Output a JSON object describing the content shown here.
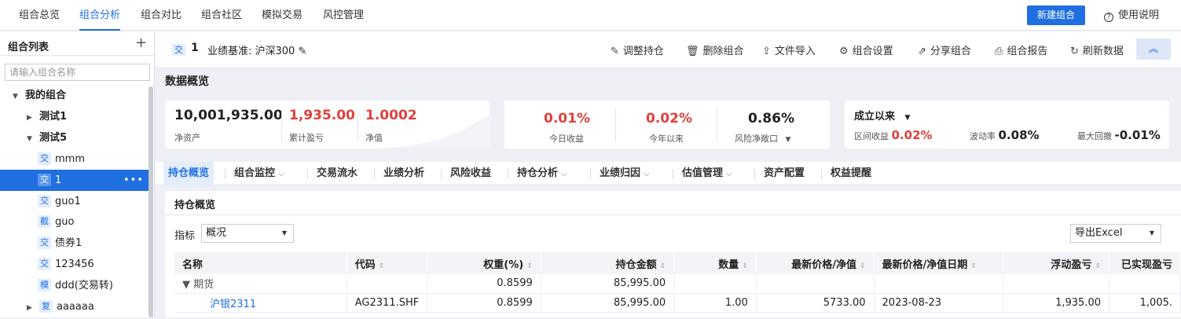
{
  "topnav": {
    "tabs": [
      "组合总览",
      "组合分析",
      "组合对比",
      "组合社区",
      "模拟交易",
      "风控管理"
    ],
    "active": 1,
    "new_button": "新建组合",
    "help": "使用说明"
  },
  "sidebar": {
    "title": "组合列表",
    "search_placeholder": "请输入组合名称",
    "items": [
      {
        "arrow": "▼",
        "tag": "",
        "label": "我的组合"
      },
      {
        "arrow": "▶",
        "tag": "",
        "label": "测试1"
      },
      {
        "arrow": "▼",
        "tag": "",
        "label": "测试5"
      },
      {
        "arrow": "",
        "tag": "交",
        "label": "mmm"
      },
      {
        "arrow": "",
        "tag": "交",
        "label": "1"
      },
      {
        "arrow": "",
        "tag": "交",
        "label": "guo1"
      },
      {
        "arrow": "",
        "tag": "截",
        "label": "guo"
      },
      {
        "arrow": "",
        "tag": "交",
        "label": "债券1"
      },
      {
        "arrow": "",
        "tag": "交",
        "label": "123456"
      },
      {
        "arrow": "",
        "tag": "模",
        "label": "ddd(交易转)"
      },
      {
        "arrow": "▶",
        "tag": "复",
        "label": "aaaaaa"
      }
    ],
    "selected_index": 4
  },
  "toolbar": {
    "portfolio_tag": "交",
    "portfolio_name": "1",
    "benchmark": "业绩基准: 沪深300",
    "actions": [
      {
        "icon": "✎",
        "label": "调整持仓"
      },
      {
        "icon": "🗑",
        "label": "删除组合"
      },
      {
        "icon": "⇪",
        "label": "文件导入"
      },
      {
        "icon": "⚙",
        "label": "组合设置"
      },
      {
        "icon": "⇗",
        "label": "分享组合"
      },
      {
        "icon": "⎙",
        "label": "组合报告"
      },
      {
        "icon": "↻",
        "label": "刷新数据"
      }
    ],
    "collapse_icon": "︽"
  },
  "overview": {
    "title": "数据概览",
    "card1": [
      {
        "value": "10,001,935.00",
        "label": "净资产",
        "color": "#222222"
      },
      {
        "value": "1,935.00",
        "label": "累计盈亏",
        "color": "#e0403b"
      },
      {
        "value": "1.0002",
        "label": "净值",
        "color": "#e0403b"
      }
    ],
    "card2": [
      {
        "value": "0.01%",
        "label": "今日收益",
        "color": "#e0403b"
      },
      {
        "value": "0.02%",
        "label": "今年以来",
        "color": "#e0403b"
      },
      {
        "value": "0.86%",
        "label": "风险净敞口",
        "color": "#222222"
      }
    ],
    "card3": {
      "period": "成立以来",
      "interval_label": "区间收益",
      "interval_value": "0.02%",
      "vol_label": "波动率",
      "vol_value": "0.08%",
      "dd_label": "最大回撤",
      "dd_value": "-0.01%"
    }
  },
  "subtabs": [
    {
      "label": "持仓概览",
      "dd": false
    },
    {
      "label": "组合监控",
      "dd": true
    },
    {
      "label": "交易流水",
      "dd": false
    },
    {
      "label": "业绩分析",
      "dd": false
    },
    {
      "label": "风险收益",
      "dd": false
    },
    {
      "label": "持仓分析",
      "dd": true
    },
    {
      "label": "业绩归因",
      "dd": true
    },
    {
      "label": "估值管理",
      "dd": true
    },
    {
      "label": "资产配置",
      "dd": false
    },
    {
      "label": "权益提醒",
      "dd": false
    }
  ],
  "panel": {
    "title": "持仓概览",
    "indicator_label": "指标",
    "indicator_value": "概况",
    "export_label": "导出Excel",
    "columns": [
      "名称",
      "代码",
      "权重(%)",
      "持仓金额",
      "数量",
      "最新价格/净值",
      "最新价格/净值日期",
      "浮动盈亏",
      "已实现盈亏"
    ],
    "rows": [
      [
        "▼ 期货",
        "",
        "0.8599",
        "85,995.00",
        "",
        "",
        "",
        "",
        ""
      ],
      [
        "沪银2311",
        "AG2311.SHF",
        "0.8599",
        "85,995.00",
        "1.00",
        "5733.00",
        "2023-08-23",
        "1,935.00",
        "1,005."
      ]
    ]
  }
}
